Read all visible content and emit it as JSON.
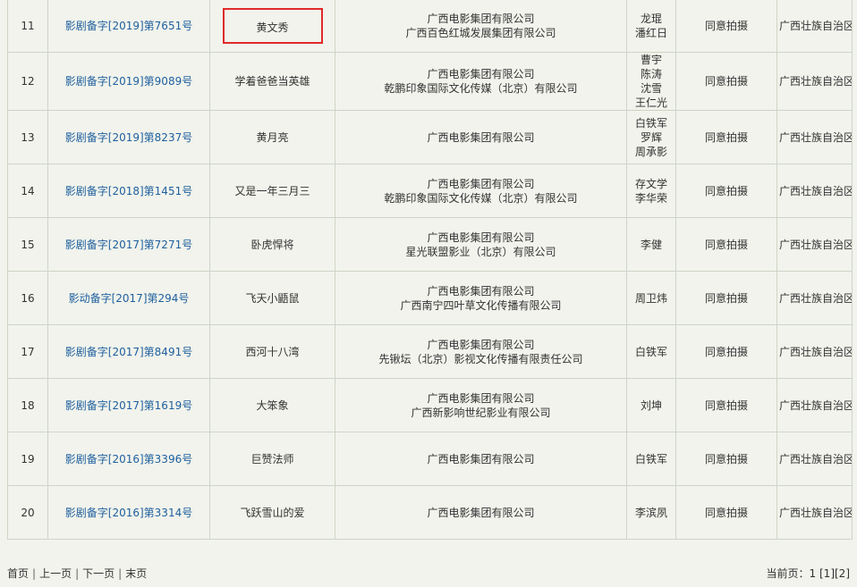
{
  "rows": [
    {
      "num": "11",
      "record": "影剧备字[2019]第7651号",
      "title": "黄文秀",
      "companies": [
        "广西电影集团有限公司",
        "广西百色红城发展集团有限公司"
      ],
      "writers": [
        "龙琨",
        "潘红日"
      ],
      "opinion": "同意拍摄",
      "region": "广西壮族自治区",
      "highlight": true
    },
    {
      "num": "12",
      "record": "影剧备字[2019]第9089号",
      "title": "学着爸爸当英雄",
      "companies": [
        "广西电影集团有限公司",
        "乾鹏印象国际文化传媒（北京）有限公司"
      ],
      "writers": [
        "曹宇",
        "陈涛",
        "沈雪",
        "王仁光"
      ],
      "opinion": "同意拍摄",
      "region": "广西壮族自治区"
    },
    {
      "num": "13",
      "record": "影剧备字[2019]第8237号",
      "title": "黄月亮",
      "companies": [
        "广西电影集团有限公司"
      ],
      "writers": [
        "白铁军",
        "罗辉",
        "周承影"
      ],
      "opinion": "同意拍摄",
      "region": "广西壮族自治区"
    },
    {
      "num": "14",
      "record": "影剧备字[2018]第1451号",
      "title": "又是一年三月三",
      "companies": [
        "广西电影集团有限公司",
        "乾鹏印象国际文化传媒（北京）有限公司"
      ],
      "writers": [
        "存文学",
        "李华荣"
      ],
      "opinion": "同意拍摄",
      "region": "广西壮族自治区"
    },
    {
      "num": "15",
      "record": "影剧备字[2017]第7271号",
      "title": "卧虎悍将",
      "companies": [
        "广西电影集团有限公司",
        "星光联盟影业（北京）有限公司"
      ],
      "writers": [
        "李健"
      ],
      "opinion": "同意拍摄",
      "region": "广西壮族自治区"
    },
    {
      "num": "16",
      "record": "影动备字[2017]第294号",
      "title": "飞天小鼯鼠",
      "companies": [
        "广西电影集团有限公司",
        "广西南宁四叶草文化传播有限公司"
      ],
      "writers": [
        "周卫炜"
      ],
      "opinion": "同意拍摄",
      "region": "广西壮族自治区"
    },
    {
      "num": "17",
      "record": "影剧备字[2017]第8491号",
      "title": "西河十八湾",
      "companies": [
        "广西电影集团有限公司",
        "先锹坛（北京）影视文化传播有限责任公司"
      ],
      "writers": [
        "白铁军"
      ],
      "opinion": "同意拍摄",
      "region": "广西壮族自治区"
    },
    {
      "num": "18",
      "record": "影剧备字[2017]第1619号",
      "title": "大笨象",
      "companies": [
        "广西电影集团有限公司",
        "广西新影响世纪影业有限公司"
      ],
      "writers": [
        "刘坤"
      ],
      "opinion": "同意拍摄",
      "region": "广西壮族自治区"
    },
    {
      "num": "19",
      "record": "影剧备字[2016]第3396号",
      "title": "巨赞法师",
      "companies": [
        "广西电影集团有限公司"
      ],
      "writers": [
        "白铁军"
      ],
      "opinion": "同意拍摄",
      "region": "广西壮族自治区"
    },
    {
      "num": "20",
      "record": "影剧备字[2016]第3314号",
      "title": "飞跃雪山的爱",
      "companies": [
        "广西电影集团有限公司"
      ],
      "writers": [
        "李滨夙"
      ],
      "opinion": "同意拍摄",
      "region": "广西壮族自治区"
    }
  ],
  "pager": {
    "first": "首页",
    "prev": "上一页",
    "next": "下一页",
    "last": "末页",
    "sep": "|"
  },
  "page_info": {
    "label": "当前页：",
    "current": "1",
    "pages": [
      "[1]",
      "[2]"
    ]
  }
}
